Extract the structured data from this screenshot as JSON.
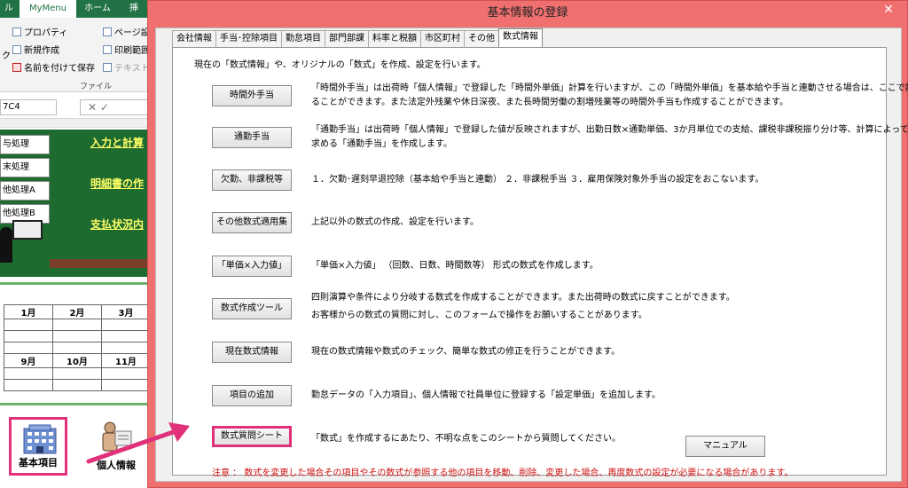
{
  "excel": {
    "tabs": [
      "ル",
      "MyMenu",
      "ホーム",
      "挿"
    ],
    "ribbon": {
      "properties": "プロパティ",
      "new": "新規作成",
      "save_as": "名前を付けて保存",
      "page_setup": "ページ設",
      "print_range": "印刷範囲",
      "text": "テキスト",
      "group_label": "ファイル",
      "fragment": "ク"
    },
    "name_box": "7C4",
    "fx_buttons": "✕  ✓",
    "side_buttons": [
      "与処理",
      "末処理",
      "他処理A",
      "他処理B"
    ],
    "green_links": [
      "入力と計算",
      "明細書の作",
      "支払状況内"
    ],
    "months": [
      [
        "1月",
        "2月",
        "3月"
      ],
      [
        "9月",
        "10月",
        "11月"
      ]
    ],
    "icons": {
      "basic": "基本項目",
      "person": "個人情報"
    }
  },
  "dialog": {
    "title": "基本情報の登録",
    "close": "✕",
    "tabs": [
      "会社情報",
      "手当･控除項目",
      "勤怠項目",
      "部門部課",
      "料率と税額",
      "市区町村",
      "その他",
      "数式情報"
    ],
    "active_tab": 7,
    "intro": "現在の「数式情報」や、オリジナルの「数式」を作成、設定を行います。",
    "rows": [
      {
        "button": "時間外手当",
        "desc": [
          "「時間外手当」は出荷時「個人情報」で登録した「時間外単価」計算を行いますが、この「時間外単価」を基本給や手当と連動させる場合は、ここで設定す",
          "ることができます。また法定外残業や休日深夜、また長時間労働の割増残業等の時間外手当も作成することができます。"
        ]
      },
      {
        "button": "通勤手当",
        "desc": [
          "「通勤手当」は出荷時「個人情報」で登録した値が反映されますが、出勤日数×通勤単価、3か月単位での支給、課税非課税振り分け等、計算によって",
          "求める「通勤手当」を作成します。"
        ]
      },
      {
        "button": "欠勤、非課税等",
        "desc": [
          "１．欠勤･遅刻早退控除（基本給や手当と連動） ２．非課税手当 ３．雇用保険対象外手当の設定をおこないます。"
        ]
      },
      {
        "button": "その他数式適用集",
        "desc": [
          "上記以外の数式の作成、設定を行います。"
        ]
      },
      {
        "button": "「単価×入力値」",
        "desc": [
          "「単価×入力値」 （回数、日数、時間数等） 形式の数式を作成します。"
        ]
      },
      {
        "button": "数式作成ツール",
        "desc": [
          "四則演算や条件により分岐する数式を作成することができます。また出荷時の数式に戻すことができます。",
          "お客様からの数式の質問に対し、このフォームで操作をお願いすることがあります。"
        ]
      },
      {
        "button": "現在数式情報",
        "desc": [
          "現在の数式情報や数式のチェック、簡単な数式の修正を行うことができます。"
        ]
      },
      {
        "button": "項目の追加",
        "desc": [
          "勤怠データの「入力項目」、個人情報で社員単位に登録する「設定単価」を追加します。"
        ]
      },
      {
        "button": "数式質問シート",
        "desc": [
          "「数式」を作成するにあたり、不明な点をこのシートから質問してください。"
        ]
      }
    ],
    "manual_button": "マニュアル",
    "note": "注意 ： 数式を変更した場合その項目やその数式が参照する他の項目を移動、削除、変更した場合、再度数式の設定が必要になる場合があります。",
    "colors": {
      "title_bar": "#f07070",
      "highlight": "#e0317a",
      "note": "#d01010"
    }
  }
}
